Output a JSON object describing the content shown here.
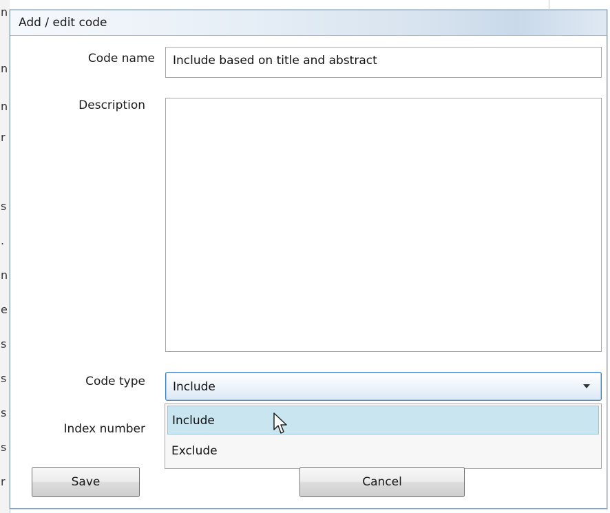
{
  "background": {
    "edge_glyphs": [
      "n",
      "n",
      "n",
      "r",
      "s",
      ".",
      "n",
      "e",
      "s",
      "s",
      "s",
      "s",
      "r"
    ]
  },
  "dialog": {
    "title": "Add / edit code",
    "code_name": {
      "label": "Code name",
      "value": "Include based on title and abstract"
    },
    "description": {
      "label": "Description",
      "value": ""
    },
    "code_type": {
      "label": "Code type",
      "selected": "Include",
      "options": [
        "Include",
        "Exclude"
      ],
      "hovered_option": "Include"
    },
    "index_number": {
      "label": "Index number"
    },
    "buttons": {
      "save": "Save",
      "cancel": "Cancel"
    }
  },
  "colors": {
    "accent_border": "#3f7fbf",
    "hover_option": "#c9e5ef"
  }
}
